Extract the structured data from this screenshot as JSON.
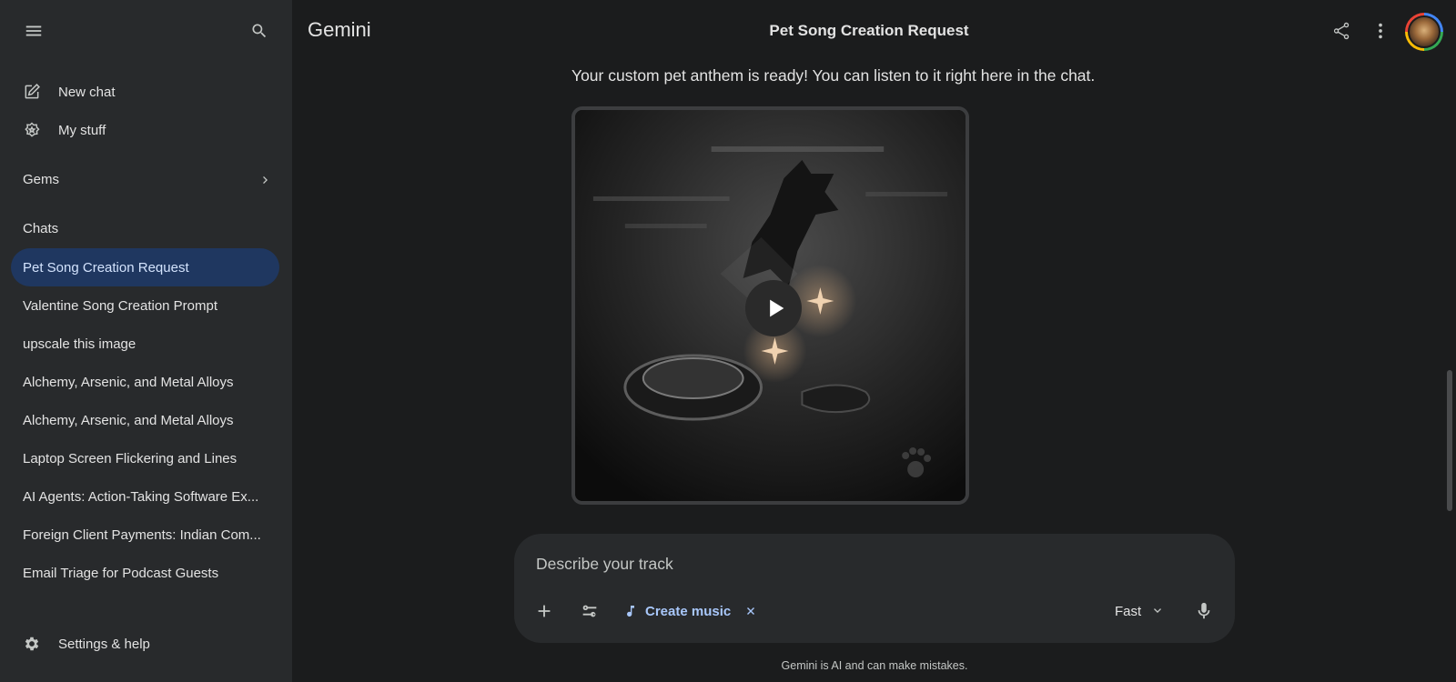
{
  "sidebar": {
    "menu_icon": "menu-icon",
    "search_icon": "search-icon",
    "new_chat": "New chat",
    "my_stuff": "My stuff",
    "gems": "Gems",
    "chats_header": "Chats",
    "chats": [
      {
        "label": "Pet Song Creation Request",
        "active": true
      },
      {
        "label": "Valentine Song Creation Prompt"
      },
      {
        "label": "upscale this image"
      },
      {
        "label": "Alchemy, Arsenic, and Metal Alloys"
      },
      {
        "label": "Alchemy, Arsenic, and Metal Alloys"
      },
      {
        "label": "Laptop Screen Flickering and Lines"
      },
      {
        "label": "AI Agents: Action-Taking Software Ex..."
      },
      {
        "label": "Foreign Client Payments: Indian Com..."
      },
      {
        "label": "Email Triage for Podcast Guests"
      }
    ],
    "settings": "Settings & help"
  },
  "header": {
    "brand": "Gemini",
    "title": "Pet Song Creation Request"
  },
  "conversation": {
    "message": "Your custom pet anthem is ready! You can listen to it right here in the chat."
  },
  "composer": {
    "placeholder": "Describe your track",
    "chip_label": "Create music",
    "mode": "Fast"
  },
  "footer": {
    "disclaimer": "Gemini is AI and can make mistakes."
  },
  "colors": {
    "background": "#1b1c1d",
    "sidebar": "#282a2c",
    "active_chat": "#1f3760",
    "accent": "#a8c7fa"
  }
}
